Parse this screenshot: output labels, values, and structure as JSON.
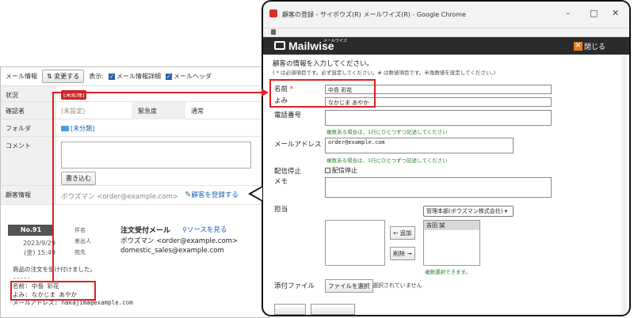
{
  "left_panel": {
    "toolbar": {
      "section_title": "メール情報",
      "change_button": "⇅ 変更する",
      "display_label": "表示:",
      "check_mail_detail": "メール情報詳細",
      "check_mail_header": "メールヘッダ"
    },
    "status": {
      "label": "状況",
      "badge": "[未処理]"
    },
    "checker": {
      "label": "確認者",
      "value": "(未設定)",
      "urgency_label": "緊急度",
      "urgency_value": "通常"
    },
    "folder": {
      "label": "フォルダ",
      "value": "[未分類]"
    },
    "comment": {
      "label": "コメント",
      "button": "書き込む"
    },
    "customer": {
      "label": "顧客情報",
      "value": "ボウズマン <order@example.com>",
      "register_link": "顧客を登録する"
    },
    "mail": {
      "number": "No.91",
      "date": "2023/9/29",
      "time": "(金) 15:49",
      "subject_label": "件名",
      "subject": "注文受付メール",
      "source_link": "ソースを見る",
      "from_label": "差出人",
      "from": "ボウズマン <order@example.com>",
      "to_label": "宛先",
      "to": "domestic_sales@example.com"
    },
    "body": {
      "line1": "商品の注文を受け付けました。",
      "line2": "-----",
      "line3": "名前: 中島 彩花",
      "line4": "よみ: なかじま あやか",
      "line5": "メールアドレス: nakajima@example.com"
    }
  },
  "window": {
    "title": "顧客の登録 - サイボウズ(R) メールワイズ(R) - Google Chrome",
    "controls": {
      "minimize": "–",
      "maximize": "□",
      "close": "✕"
    },
    "app": {
      "logo": "Mailwise",
      "logo_sub": "メールワイズ",
      "close_label": "閉じる",
      "close_icon": "✕"
    },
    "intro": "顧客の情報を入力してください。",
    "note": "( * は必須項目です。必ず設定してください。# は数値項目です。半角数値を設定してください。)",
    "form": {
      "name_label": "名前",
      "required_mark": "*",
      "name_value": "中島 彩花",
      "yomi_label": "よみ",
      "yomi_value": "なかじま あやか",
      "phone_label": "電話番号",
      "phone_hint": "複数ある場合は、1行にひとつずつ記述してください",
      "email_label": "メールアドレス",
      "email_value": "order@example.com",
      "email_hint": "複数ある場合は、1行にひとつずつ記述してください",
      "stop_label": "配信停止",
      "stop_check_label": "配信停止",
      "memo_label": "メモ",
      "assignee_label": "担当",
      "org_select": "管理本部(ボウズマン株式会社)",
      "add_button": "← 追加",
      "remove_button": "削除 →",
      "assigned_user": "吉田 誠",
      "multi_hint": "複数選択できます。",
      "attach_label": "添付ファイル",
      "file_button": "ファイルを選択",
      "no_file": "選択されていません"
    }
  }
}
